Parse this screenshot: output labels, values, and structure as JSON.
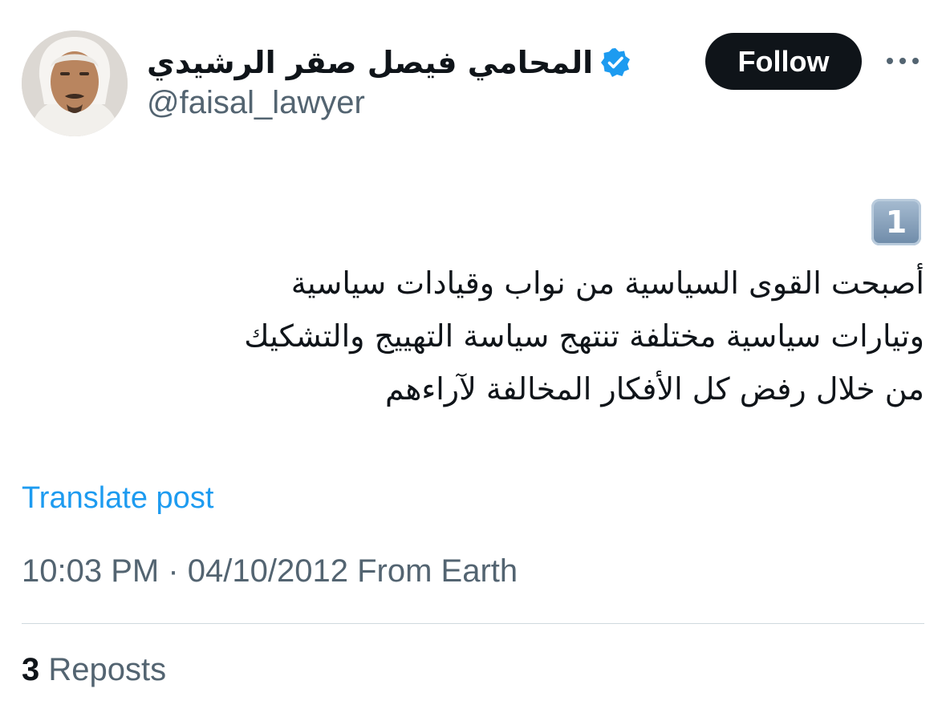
{
  "author": {
    "display_name": "المحامي فيصل صقر الرشيدي",
    "handle": "@faisal_lawyer",
    "verified": true
  },
  "actions": {
    "follow_label": "Follow",
    "more_icon": "more-horizontal-icon"
  },
  "tweet": {
    "emoji_number": "1",
    "lines": [
      "أصبحت القوى السياسية من نواب وقيادات سياسية",
      "وتيارات سياسية مختلفة تنتهج سياسة التهييج والتشكيك",
      "من خلال رفض كل الأفكار المخالفة لآراءهم"
    ]
  },
  "translate_label": "Translate post",
  "meta": {
    "time": "10:03 PM",
    "separator": " · ",
    "date": "04/10/2012",
    "source": " From Earth"
  },
  "stats": {
    "reposts_count": "3",
    "reposts_label": " Reposts"
  },
  "colors": {
    "verified_blue": "#1d9bf0",
    "link_blue": "#1d9bf0",
    "secondary_text": "#536471",
    "follow_bg": "#0f1419"
  }
}
